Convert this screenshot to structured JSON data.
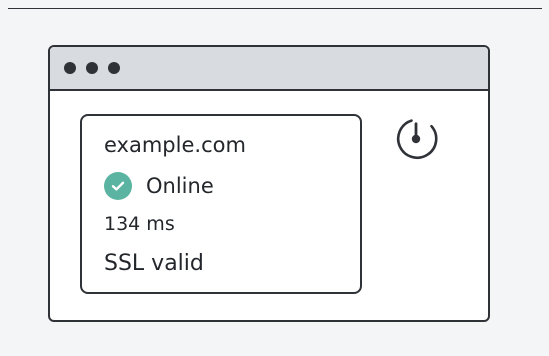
{
  "status_card": {
    "domain": "example.com",
    "status": "Online",
    "response_time": "134 ms",
    "ssl": "SSL valid"
  },
  "icons": {
    "status_icon": "check-circle-icon",
    "timer_icon": "stopwatch-icon",
    "window_dots": [
      "window-dot-icon",
      "window-dot-icon",
      "window-dot-icon"
    ]
  },
  "colors": {
    "accent_green": "#5bb4a1",
    "outline": "#2f3338",
    "titlebar": "#d8dbdf",
    "background": "#f4f5f7"
  }
}
